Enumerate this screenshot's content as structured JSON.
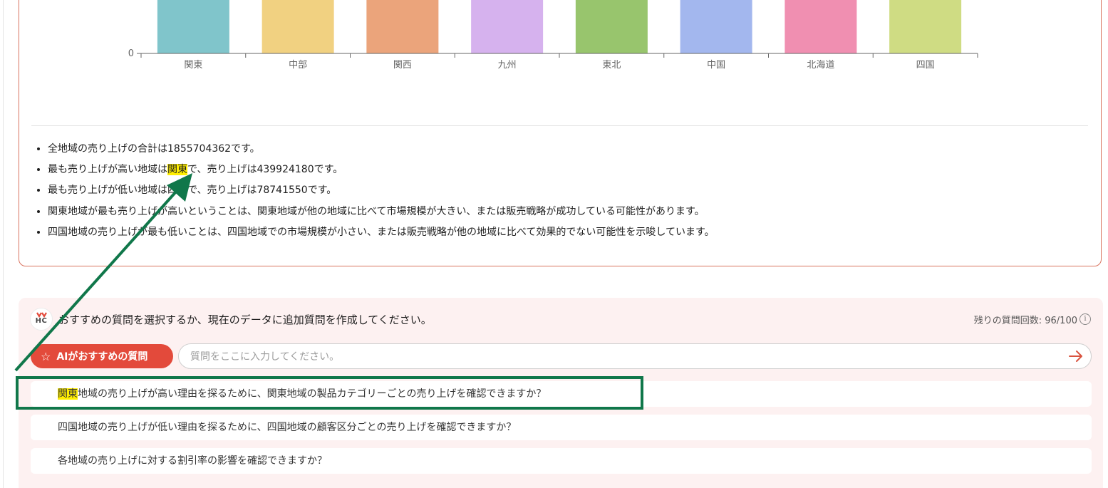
{
  "chart_data": {
    "type": "bar",
    "categories": [
      "関東",
      "中部",
      "関西",
      "九州",
      "東北",
      "中国",
      "北海道",
      "四国"
    ],
    "colors": [
      "#80c5cb",
      "#f1d181",
      "#eba47b",
      "#d6b2ee",
      "#98c56d",
      "#a3b7ee",
      "#f08fb1",
      "#cfdc83"
    ],
    "y_tick_labels": [
      "0"
    ],
    "xlabel": "",
    "ylabel": ""
  },
  "insights": [
    {
      "pre": "全地域の売り上げの合計は1855704362です。",
      "hl": "",
      "post": ""
    },
    {
      "pre": "最も売り上げが高い地域は",
      "hl": "関東",
      "post": "で、売り上げは439924180です。"
    },
    {
      "pre": "最も売り上げが低い地域は四国で、売り上げは78741550です。",
      "hl": "",
      "post": ""
    },
    {
      "pre": "関東地域が最も売り上げが高いということは、関東地域が他の地域に比べて市場規模が大きい、または販売戦略が成功している可能性があります。",
      "hl": "",
      "post": ""
    },
    {
      "pre": "四国地域の売り上げが最も低いことは、四国地域での市場規模が小さい、または販売戦略が他の地域に比べて効果的でない可能性を示唆しています。",
      "hl": "",
      "post": ""
    }
  ],
  "question_panel": {
    "logo_text": "HC",
    "prompt": "おすすめの質問を選択するか、現在のデータに追加質問を作成してください。",
    "remaining": "残りの質問回数: 96/100",
    "info_icon": "i",
    "ai_button": {
      "icon": "☆",
      "label": "AIがおすすめの質問"
    },
    "input_placeholder": "質問をここに入力してください。",
    "send_icon": "arrow-right-icon",
    "suggestions": [
      {
        "hl": "関東",
        "text": "地域の売り上げが高い理由を探るために、関東地域の製品カテゴリーごとの売り上げを確認できますか？"
      },
      {
        "hl": "",
        "text": "四国地域の売り上げが低い理由を探るために、四国地域の顧客区分ごとの売り上げを確認できますか？"
      },
      {
        "hl": "",
        "text": "各地域の売り上げに対する割引率の影響を確認できますか？"
      }
    ]
  },
  "annotation_color": "#10774a",
  "brand_color": "#e34a3b"
}
